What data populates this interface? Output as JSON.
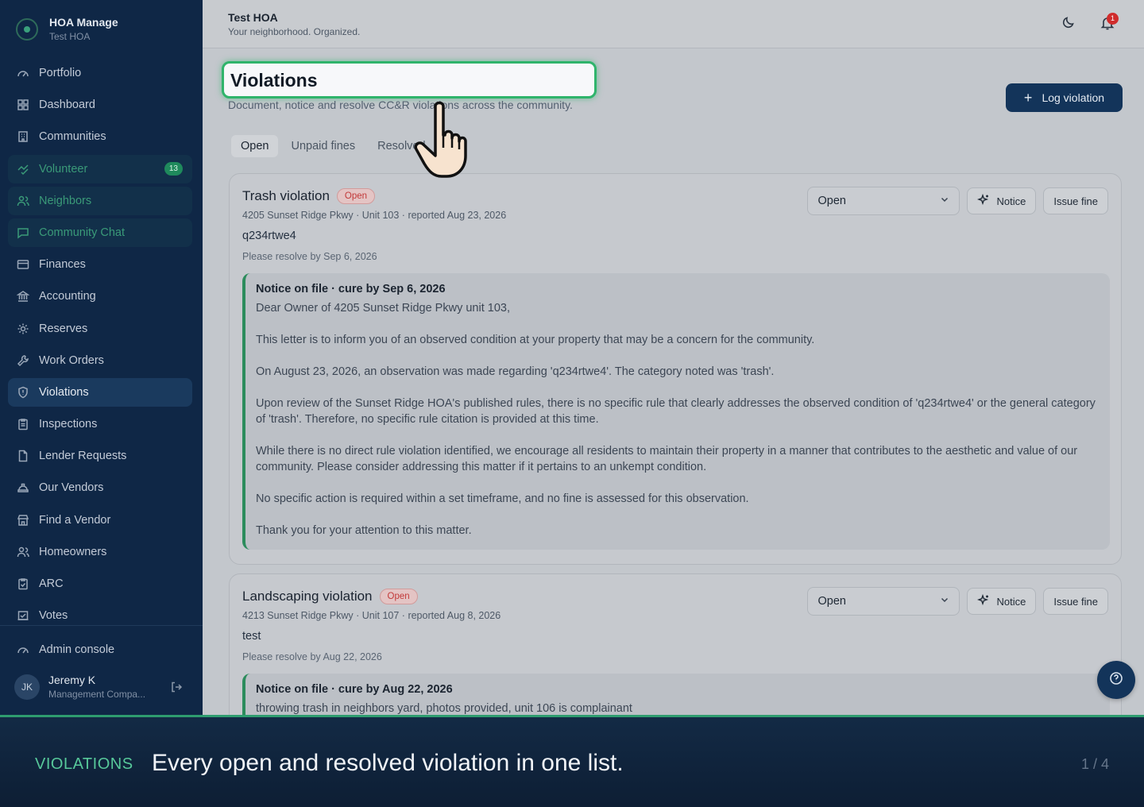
{
  "brand": {
    "title": "HOA Manage",
    "subtitle": "Test HOA"
  },
  "sidebar": {
    "items": [
      {
        "label": "Portfolio",
        "icon": "gauge-icon"
      },
      {
        "label": "Dashboard",
        "icon": "grid-icon"
      },
      {
        "label": "Communities",
        "icon": "building-icon"
      },
      {
        "label": "Volunteer",
        "icon": "handshake-icon",
        "badge": "13"
      },
      {
        "label": "Neighbors",
        "icon": "users-icon"
      },
      {
        "label": "Community Chat",
        "icon": "chat-icon"
      },
      {
        "label": "Finances",
        "icon": "card-icon"
      },
      {
        "label": "Accounting",
        "icon": "bank-icon"
      },
      {
        "label": "Reserves",
        "icon": "gear-icon"
      },
      {
        "label": "Work Orders",
        "icon": "wrench-icon"
      },
      {
        "label": "Violations",
        "icon": "shield-icon"
      },
      {
        "label": "Inspections",
        "icon": "clipboard-icon"
      },
      {
        "label": "Lender Requests",
        "icon": "document-icon"
      },
      {
        "label": "Our Vendors",
        "icon": "hardhat-icon"
      },
      {
        "label": "Find a Vendor",
        "icon": "store-icon"
      },
      {
        "label": "Homeowners",
        "icon": "users-icon"
      },
      {
        "label": "ARC",
        "icon": "clipboard-check-icon"
      },
      {
        "label": "Votes",
        "icon": "ballot-icon"
      }
    ],
    "admin": {
      "label": "Admin console",
      "icon": "gauge-icon"
    },
    "user": {
      "initials": "JK",
      "name": "Jeremy K",
      "role": "Management Compa..."
    }
  },
  "topbar": {
    "title": "Test HOA",
    "subtitle": "Your neighborhood. Organized.",
    "notification_count": "1"
  },
  "page": {
    "title": "Violations",
    "description": "Document, notice and resolve CC&R violations across the community.",
    "log_button": "Log violation",
    "tabs": [
      "Open",
      "Unpaid fines",
      "Resolved"
    ]
  },
  "violations": [
    {
      "title": "Trash violation",
      "status": "Open",
      "meta": "4205 Sunset Ridge Pkwy · Unit 103 · reported Aug 23, 2026",
      "description": "q234rtwe4",
      "resolve_by": "Please resolve by Sep 6, 2026",
      "select_value": "Open",
      "notice_label": "Notice",
      "fine_label": "Issue fine",
      "notice_head": "Notice on file · cure by Sep 6, 2026",
      "notice_body": [
        "Dear Owner of 4205 Sunset Ridge Pkwy unit 103,",
        "This letter is to inform you of an observed condition at your property that may be a concern for the community.",
        "On August 23, 2026, an observation was made regarding 'q234rtwe4'. The category noted was 'trash'.",
        "Upon review of the Sunset Ridge HOA's published rules, there is no specific rule that clearly addresses the observed condition of 'q234rtwe4' or the general category of 'trash'. Therefore, no specific rule citation is provided at this time.",
        "While there is no direct rule violation identified, we encourage all residents to maintain their property in a manner that contributes to the aesthetic and value of our community. Please consider addressing this matter if it pertains to an unkempt condition.",
        "No specific action is required within a set timeframe, and no fine is assessed for this observation.",
        "Thank you for your attention to this matter."
      ]
    },
    {
      "title": "Landscaping violation",
      "status": "Open",
      "meta": "4213 Sunset Ridge Pkwy · Unit 107 · reported Aug 8, 2026",
      "description": "test",
      "resolve_by": "Please resolve by Aug 22, 2026",
      "select_value": "Open",
      "notice_label": "Notice",
      "fine_label": "Issue fine",
      "notice_head": "Notice on file · cure by Aug 22, 2026",
      "notice_body": [
        "throwing trash in neighbors yard, photos provided, unit 106 is complainant"
      ]
    }
  ],
  "caption": {
    "label": "VIOLATIONS",
    "text": "Every open and resolved violation in one list.",
    "page": "1 / 4"
  },
  "colors": {
    "sidebar": "#0f2746",
    "accent_green": "#2fb46b",
    "primary": "#13345a",
    "open_pill": "#c23a3a"
  }
}
